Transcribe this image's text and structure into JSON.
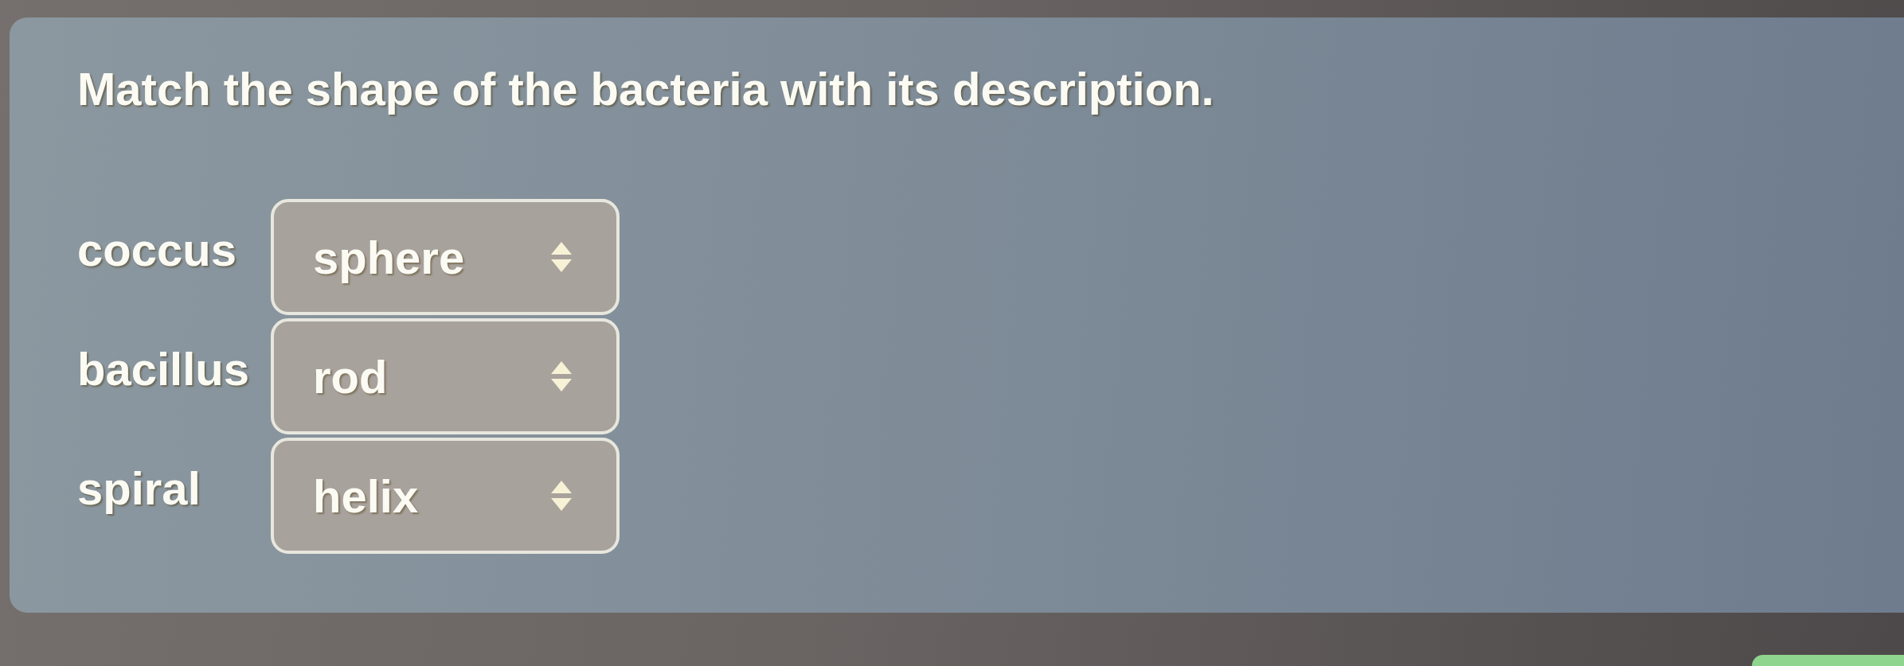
{
  "question": {
    "prompt": "Match the shape of the bacteria with its description."
  },
  "pairs": [
    {
      "term": "coccus",
      "selection": "sphere"
    },
    {
      "term": "bacillus",
      "selection": "rod"
    },
    {
      "term": "spiral",
      "selection": "helix"
    }
  ]
}
